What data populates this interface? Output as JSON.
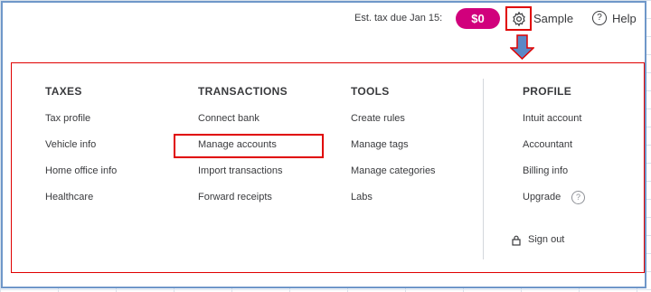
{
  "topbar": {
    "est_tax_label": "Est. tax due Jan 15:",
    "est_tax_value": "$0",
    "company": "Sample",
    "help": "Help"
  },
  "colors": {
    "accent": "#d1007c",
    "annotation_red": "#e00000",
    "arrow_blue": "#5b88c6"
  },
  "menu": {
    "columns": [
      {
        "title": "TAXES",
        "items": [
          "Tax profile",
          "Vehicle info",
          "Home office info",
          "Healthcare"
        ]
      },
      {
        "title": "TRANSACTIONS",
        "items": [
          "Connect bank",
          "Manage accounts",
          "Import transactions",
          "Forward receipts"
        ]
      },
      {
        "title": "TOOLS",
        "items": [
          "Create rules",
          "Manage tags",
          "Manage categories",
          "Labs"
        ]
      },
      {
        "title": "PROFILE",
        "items": [
          "Intuit account",
          "Accountant",
          "Billing info",
          "Upgrade"
        ],
        "sign_out": "Sign out"
      }
    ]
  },
  "icons": {
    "gear": "gear-icon",
    "help": "help-circle-icon",
    "upgrade_info": "question-circle-icon",
    "sign_out": "lock-icon"
  }
}
